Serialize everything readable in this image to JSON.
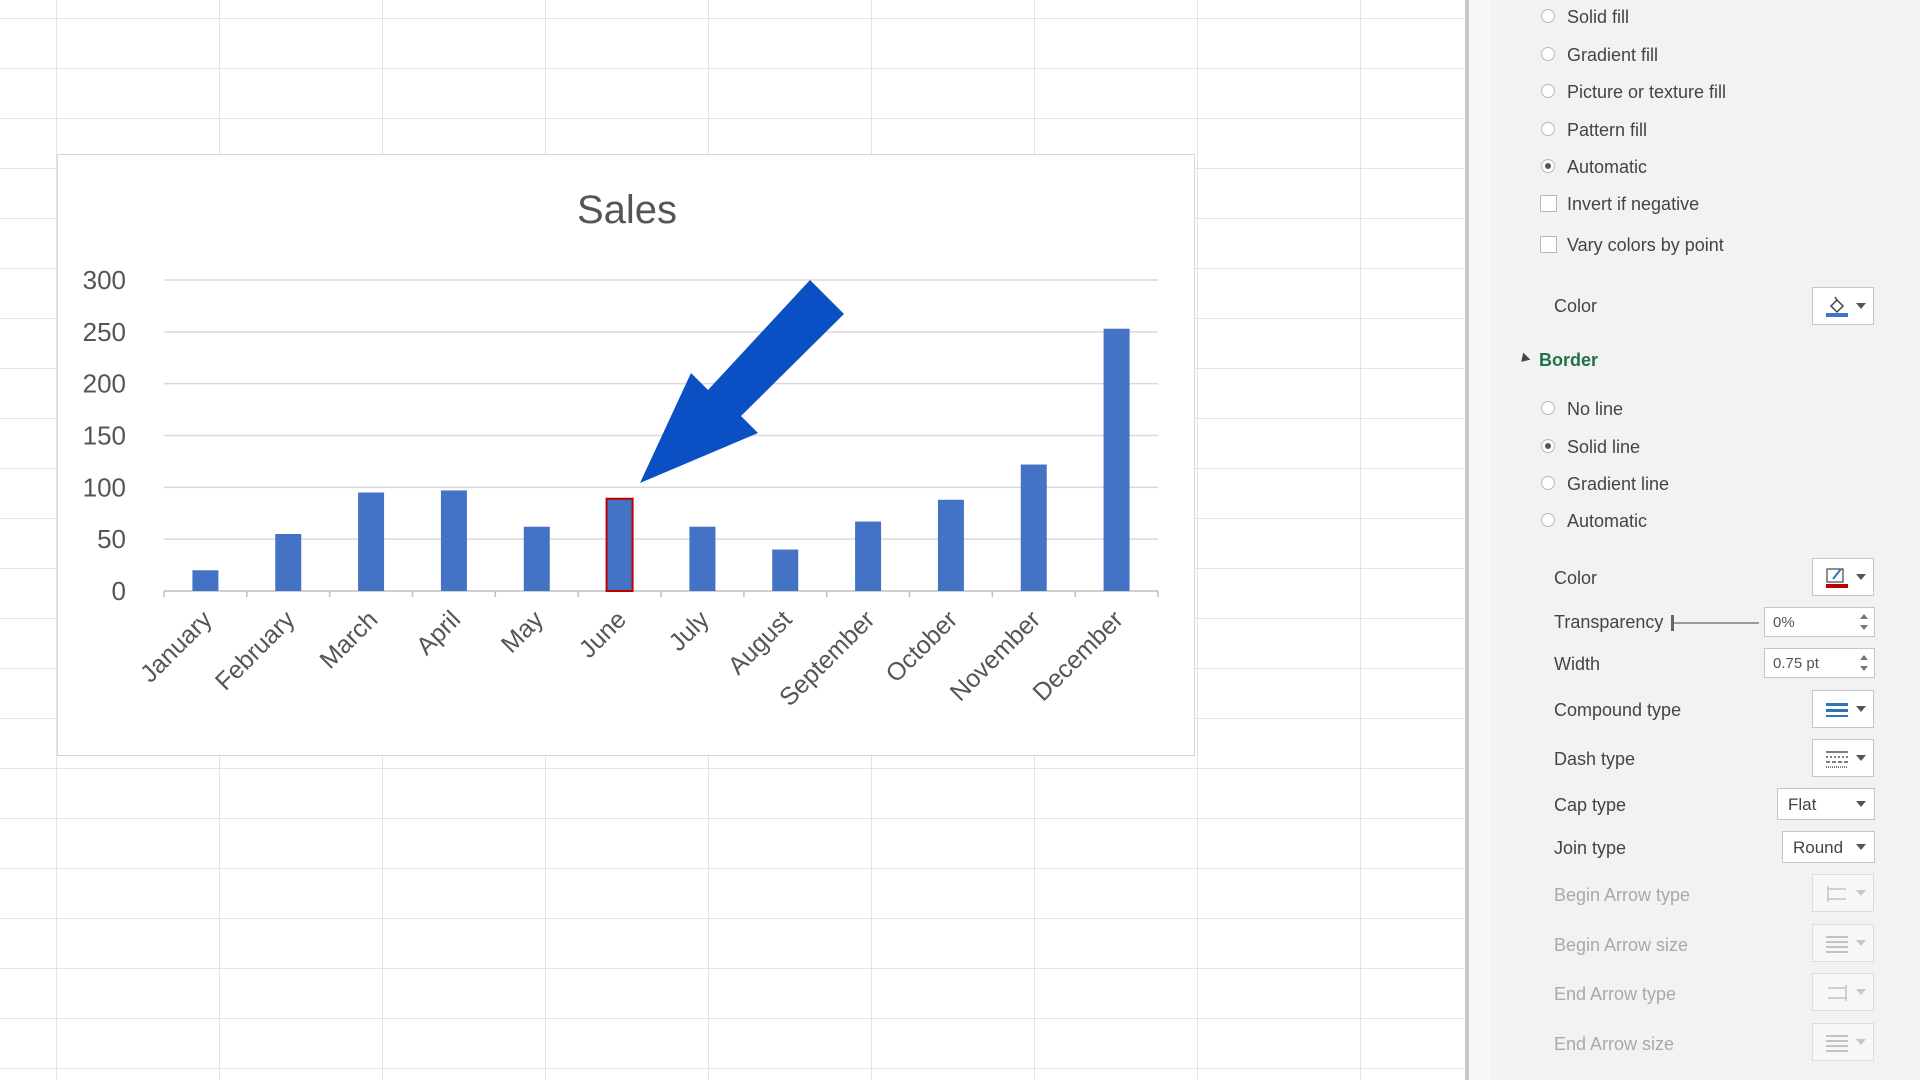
{
  "chart_data": {
    "type": "bar",
    "title": "Sales",
    "categories": [
      "January",
      "February",
      "March",
      "April",
      "May",
      "June",
      "July",
      "August",
      "September",
      "October",
      "November",
      "December"
    ],
    "values": [
      20,
      55,
      95,
      97,
      62,
      89,
      62,
      40,
      67,
      88,
      122,
      253
    ],
    "ylim": [
      0,
      300
    ],
    "yticks": [
      "0",
      "50",
      "100",
      "150",
      "200",
      "250",
      "300"
    ],
    "bar_color": "#4472c4",
    "selected_category": "June",
    "selected_border_color": "#c00000",
    "grid": true,
    "annotation": "arrow pointing at June bar",
    "arrow_color": "#0a4fc4"
  },
  "fill": {
    "options": [
      {
        "label": "Solid fill",
        "selected": false
      },
      {
        "label": "Gradient fill",
        "selected": false
      },
      {
        "label": "Picture or texture fill",
        "selected": false
      },
      {
        "label": "Pattern fill",
        "selected": false
      },
      {
        "label": "Automatic",
        "selected": true
      }
    ],
    "invert_if_negative": "Invert if negative",
    "vary_colors": "Vary colors by point",
    "color_label": "Color"
  },
  "border": {
    "heading": "Border",
    "options": [
      {
        "label": "No line",
        "selected": false
      },
      {
        "label": "Solid line",
        "selected": true
      },
      {
        "label": "Gradient line",
        "selected": false
      },
      {
        "label": "Automatic",
        "selected": false
      }
    ],
    "color_label": "Color",
    "transparency_label": "Transparency",
    "transparency_value": "0%",
    "width_label": "Width",
    "width_value": "0.75 pt",
    "compound_label": "Compound type",
    "dash_label": "Dash type",
    "cap_label": "Cap type",
    "cap_value": "Flat",
    "join_label": "Join type",
    "join_value": "Round",
    "begin_arrow_type_label": "Begin Arrow type",
    "begin_arrow_size_label": "Begin Arrow size",
    "end_arrow_type_label": "End Arrow type",
    "end_arrow_size_label": "End Arrow size",
    "border_color": "#c00000"
  },
  "icons": {
    "fill_color": "paint-bucket-icon",
    "line_color": "pen-icon",
    "compound": "compound-lines-icon",
    "dash": "dash-lines-icon",
    "arrow": "arrow-type-icon",
    "arrow_size": "arrow-size-icon"
  }
}
